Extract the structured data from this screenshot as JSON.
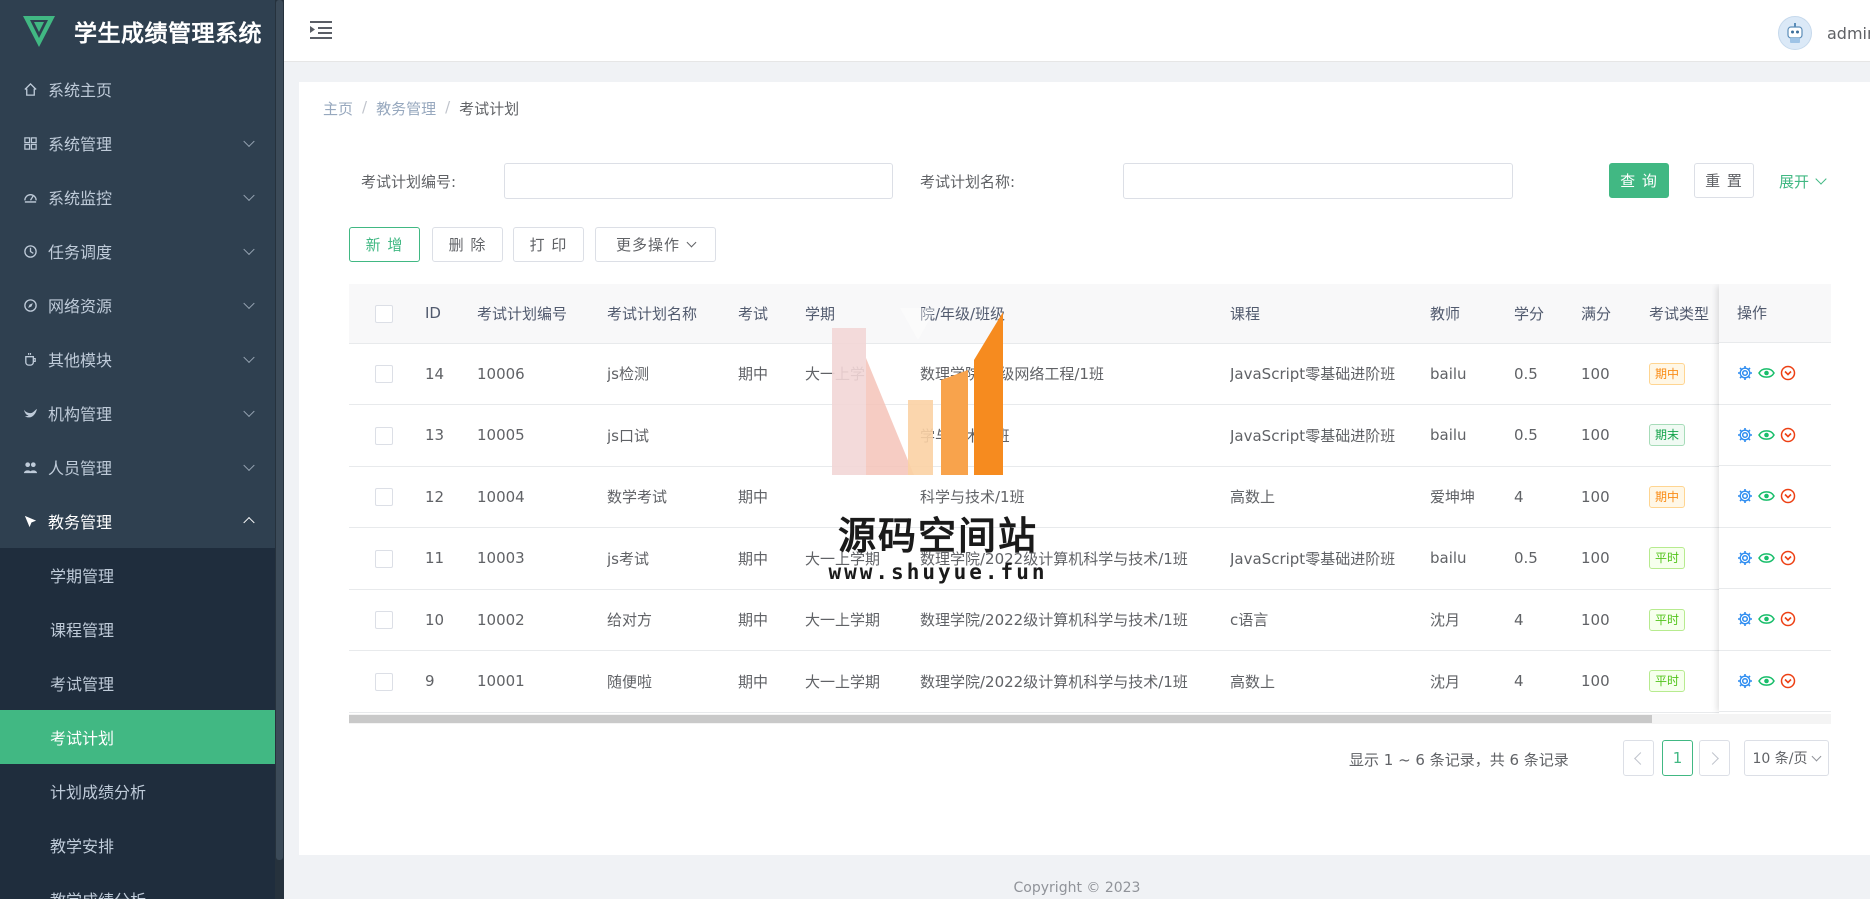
{
  "app": {
    "title": "学生成绩管理系统"
  },
  "header": {
    "username": "admin"
  },
  "sidebar": {
    "menu": [
      {
        "label": "系统主页",
        "icon": "home-icon",
        "has_children": false
      },
      {
        "label": "系统管理",
        "icon": "grid-icon",
        "has_children": true
      },
      {
        "label": "系统监控",
        "icon": "dashboard-icon",
        "has_children": true
      },
      {
        "label": "任务调度",
        "icon": "clock-icon",
        "has_children": true
      },
      {
        "label": "网络资源",
        "icon": "compass-icon",
        "has_children": true
      },
      {
        "label": "其他模块",
        "icon": "cup-icon",
        "has_children": true
      },
      {
        "label": "机构管理",
        "icon": "bird-icon",
        "has_children": true
      },
      {
        "label": "人员管理",
        "icon": "people-icon",
        "has_children": true
      },
      {
        "label": "教务管理",
        "icon": "flag-icon",
        "has_children": true,
        "open": true
      }
    ],
    "submenu": [
      {
        "label": "学期管理"
      },
      {
        "label": "课程管理"
      },
      {
        "label": "考试管理"
      },
      {
        "label": "考试计划",
        "active": true
      },
      {
        "label": "计划成绩分析"
      },
      {
        "label": "教学安排"
      },
      {
        "label": "教学成绩分析"
      }
    ]
  },
  "breadcrumb": [
    "主页",
    "教务管理",
    "考试计划"
  ],
  "breadcrumb_sep": "/",
  "search": {
    "code_label": "考试计划编号:",
    "code_value": "",
    "name_label": "考试计划名称:",
    "name_value": "",
    "query_button": "查 询",
    "reset_button": "重 置",
    "expand_link": "展开"
  },
  "toolbar": {
    "add": "新 增",
    "delete": "删 除",
    "print": "打 印",
    "more": "更多操作"
  },
  "table": {
    "columns": [
      "ID",
      "考试计划编号",
      "考试计划名称",
      "考试",
      "学期",
      "院/年级/班级",
      "课程",
      "教师",
      "学分",
      "满分",
      "考试类型",
      "操作"
    ],
    "rows": [
      {
        "id": "14",
        "code": "10006",
        "name": "js检测",
        "exam": "期中",
        "term": "大一上学",
        "clazz": "数理学院/2  级网络工程/1班",
        "course": "JavaScript零基础进阶班",
        "teacher": "bailu",
        "credit": "0.5",
        "full": "100",
        "type": "期中",
        "type_style": "mid"
      },
      {
        "id": "13",
        "code": "10005",
        "name": "js口试",
        "exam": "",
        "term": "",
        "clazz": "  学与技术/1班",
        "course": "JavaScript零基础进阶班",
        "teacher": "bailu",
        "credit": "0.5",
        "full": "100",
        "type": "期末",
        "type_style": "end"
      },
      {
        "id": "12",
        "code": "10004",
        "name": "数学考试",
        "exam": "期中",
        "term": "",
        "clazz": "  科学与技术/1班",
        "course": "高数上",
        "teacher": "爱坤坤",
        "credit": "4",
        "full": "100",
        "type": "期中",
        "type_style": "mid"
      },
      {
        "id": "11",
        "code": "10003",
        "name": "js考试",
        "exam": "期中",
        "term": "大一上学期",
        "clazz": "数理学院/2022级计算机科学与技术/1班",
        "course": "JavaScript零基础进阶班",
        "teacher": "bailu",
        "credit": "0.5",
        "full": "100",
        "type": "平时",
        "type_style": "usual"
      },
      {
        "id": "10",
        "code": "10002",
        "name": "给对方",
        "exam": "期中",
        "term": "大一上学期",
        "clazz": "数理学院/2022级计算机科学与技术/1班",
        "course": "c语言",
        "teacher": "沈月",
        "credit": "4",
        "full": "100",
        "type": "平时",
        "type_style": "usual"
      },
      {
        "id": "9",
        "code": "10001",
        "name": "随便啦",
        "exam": "期中",
        "term": "大一上学期",
        "clazz": "数理学院/2022级计算机科学与技术/1班",
        "course": "高数上",
        "teacher": "沈月",
        "credit": "4",
        "full": "100",
        "type": "平时",
        "type_style": "usual"
      }
    ]
  },
  "pagination": {
    "info": "显示 1 ~ 6 条记录，共 6 条记录",
    "current_page": "1",
    "page_size": "10 条/页"
  },
  "footer": {
    "text": "Copyright © 2023"
  },
  "watermark": {
    "text": "源码空间站",
    "url": "www.shuyue.fun"
  },
  "colors": {
    "accent": "#41b883",
    "sidebar_bg": "#2f4050",
    "submenu_bg": "#1f2d3d",
    "icon_blue": "#2d8cf0",
    "icon_green": "#19be6b",
    "icon_red": "#ed4014"
  }
}
